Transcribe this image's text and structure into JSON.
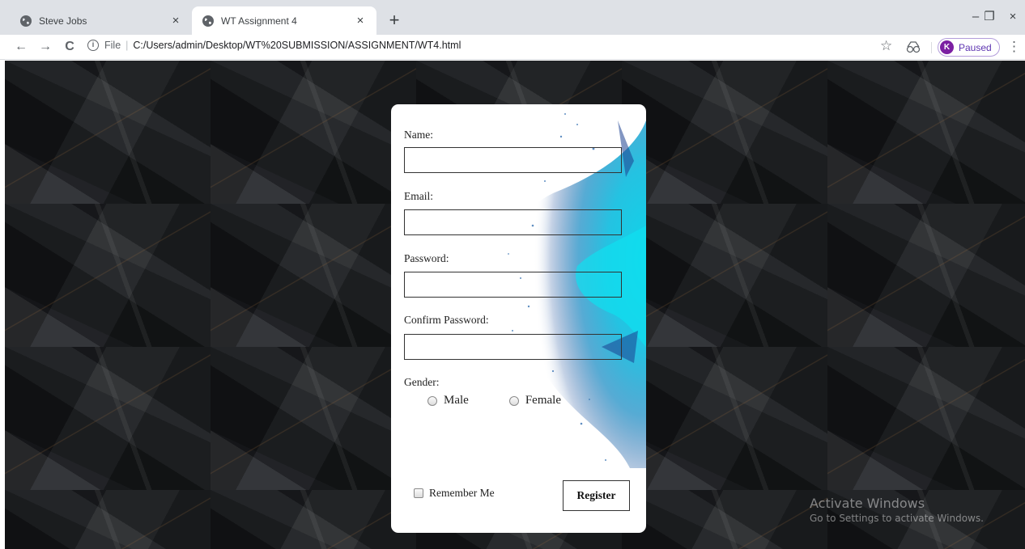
{
  "tabs": [
    {
      "title": "Steve Jobs",
      "close": "×",
      "active": false
    },
    {
      "title": "WT Assignment 4",
      "close": "×",
      "active": true
    }
  ],
  "new_tab_symbol": "+",
  "window_controls": {
    "minimize": "–",
    "restore": "❐",
    "close": "×"
  },
  "toolbar": {
    "back": "←",
    "forward": "→",
    "reload": "C",
    "info_glyph": "i",
    "scheme": "File",
    "separator": "|",
    "address": "C:/Users/admin/Desktop/WT%20SUBMISSION/ASSIGNMENT/WT4.html",
    "star": "☆",
    "profile_initial": "K",
    "profile_status": "Paused",
    "menu": "⋮"
  },
  "icons": {
    "tab_favicon": "globe-icon",
    "extension": "extension-icon"
  },
  "form": {
    "name_label": "Name:",
    "email_label": "Email:",
    "password_label": "Password:",
    "confirm_label": "Confirm Password:",
    "gender_label": "Gender:",
    "gender_options": [
      "Male",
      "Female"
    ],
    "remember_label": "Remember Me",
    "register_label": "Register",
    "values": {
      "name": "",
      "email": "",
      "password": "",
      "confirm": ""
    }
  },
  "watermark": {
    "line1": "Activate Windows",
    "line2": "Go to Settings to activate Windows."
  },
  "colors": {
    "accent_splash": "#1ec8e0",
    "background_dark": "#1c1e22",
    "profile": "#7b1fa2"
  }
}
